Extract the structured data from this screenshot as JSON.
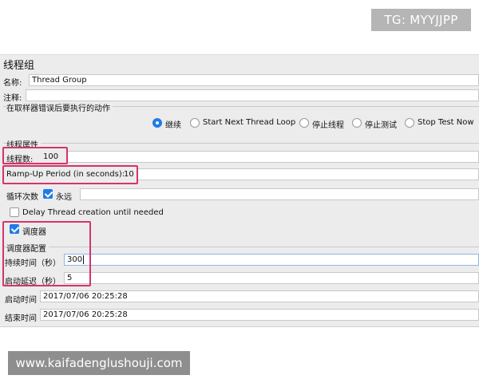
{
  "badge": "TG: MYYJJPP",
  "panel_title": "线程组",
  "name": {
    "label": "名称:",
    "value": "Thread Group"
  },
  "comment": {
    "label": "注释:",
    "value": ""
  },
  "sampler_error": {
    "title": "在取样器错误后要执行的动作",
    "options": [
      "继续",
      "Start Next Thread Loop",
      "停止线程",
      "停止测试",
      "Stop Test Now"
    ],
    "selected": "继续"
  },
  "thread_props": {
    "title": "线程属性",
    "threads": {
      "label": "线程数:",
      "value": "100"
    },
    "rampup": {
      "label": "Ramp-Up Period (in seconds):",
      "value": "10"
    },
    "loop": {
      "label": "循环次数",
      "forever_label": "永远",
      "forever_checked": true,
      "value": ""
    },
    "delay": {
      "label": "Delay Thread creation until needed",
      "checked": false
    },
    "scheduler": {
      "label": "调度器",
      "checked": true
    }
  },
  "scheduler_config": {
    "title": "调度器配置",
    "duration": {
      "label": "持续时间（秒）",
      "value": "300"
    },
    "startup_delay": {
      "label": "启动延迟（秒）",
      "value": "5"
    }
  },
  "start_time": {
    "label": "启动时间",
    "value": "2017/07/06 20:25:28"
  },
  "end_time": {
    "label": "结束时间",
    "value": "2017/07/06 20:25:28"
  },
  "watermark": "www.kaifadenglushouji.com",
  "colors": {
    "highlight": "#d6336c",
    "accent": "#1f7be8",
    "panel": "#ececec"
  }
}
